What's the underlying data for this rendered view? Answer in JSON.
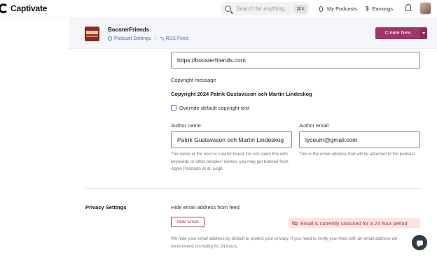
{
  "navbar": {
    "brand": "Captivate",
    "search_placeholder": "Search for anything...",
    "search_shortcut": "⌘K",
    "my_podcasts": "My Podcasts",
    "earnings": "Earnings"
  },
  "podcast_header": {
    "title": "BoosterFriends",
    "settings_link": "Podcast Settings",
    "rss_link": "RSS Feed",
    "create_button": "Create New"
  },
  "form": {
    "website_value": "https://boosterfriends.com",
    "copyright_label": "Copyright message",
    "copyright_value": "Copyright 2024 Patrik Gustavsson och Martin Lindeskog",
    "override_copyright_label": "Override default copyright text",
    "override_copyright_checked": false,
    "author_name_label": "Author name",
    "author_name_value": "Patrik Gustavsson och Martin Lindeskog",
    "author_name_help": "The name of the host or creator brand. Do not spam this with keywords or other peoples' names, you may get banned from Apple Podcasts et al. Legit.",
    "author_email_label": "Author email",
    "author_email_value": "lyceum@gmail.com",
    "author_email_help": "This is the email address that will be attached to the podcast."
  },
  "privacy": {
    "section_title": "Privacy Settings",
    "hide_email_label": "Hide email address from feed",
    "hide_email_button": "Hide Email",
    "unlock_status": "Email is currently unlocked for a 24 hour period",
    "help": "We hide your email address by default to protect your privacy. If you need to verify your feed with an email address we recommend un-hiding for 24 hours."
  },
  "colors": {
    "accent": "#a3336b",
    "link": "#4a6fb5",
    "warning_bg": "#fde4e4",
    "warning_text": "#b22e2e"
  }
}
